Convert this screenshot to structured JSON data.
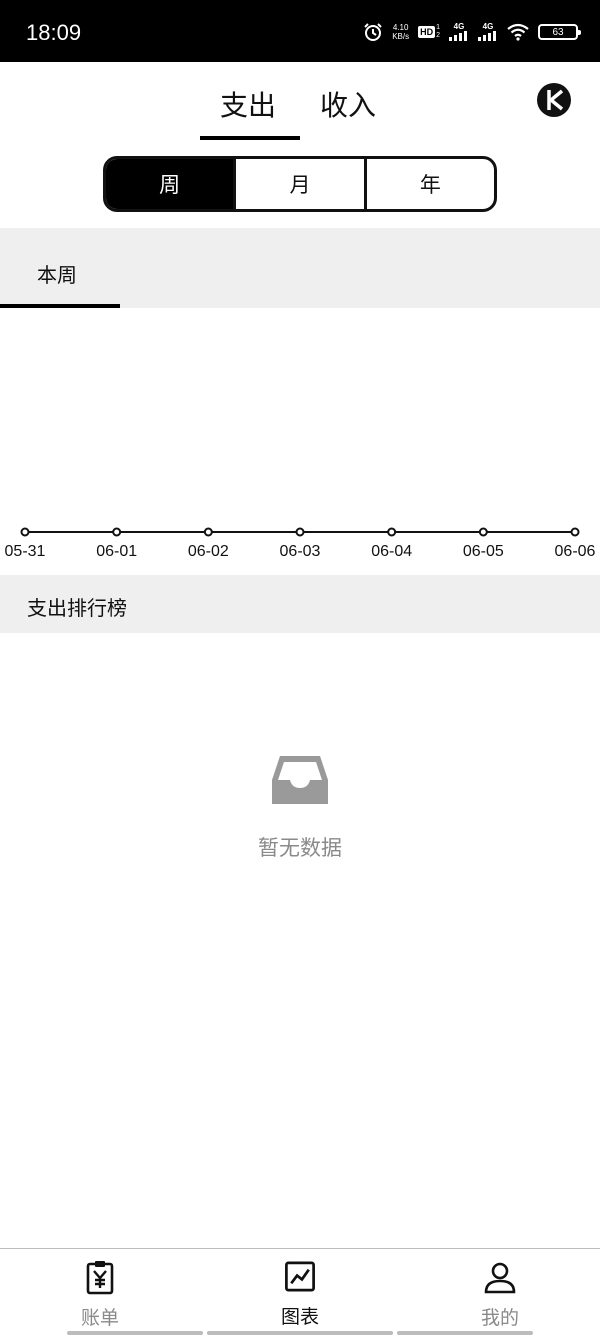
{
  "status_bar": {
    "time": "18:09",
    "net_speed_value": "4.10",
    "net_speed_unit": "KB/s",
    "hd_badge": "HD",
    "hd_sim_top": "1",
    "hd_sim_bottom": "2",
    "signal1_label": "4G",
    "signal2_label": "4G",
    "battery_level": "63",
    "icons": [
      "alarm-icon",
      "hd-icon",
      "signal-icon",
      "signal-icon",
      "wifi-icon",
      "battery-icon"
    ]
  },
  "top_tabs": {
    "expense": "支出",
    "income": "收入",
    "active": "expense",
    "switch_icon": "pie-chart-icon"
  },
  "period": {
    "week": "周",
    "month": "月",
    "year": "年",
    "active": "week"
  },
  "week_tab": {
    "label": "本周"
  },
  "chart_data": {
    "type": "line",
    "categories": [
      "05-31",
      "06-01",
      "06-02",
      "06-03",
      "06-04",
      "06-05",
      "06-06"
    ],
    "values": [
      0,
      0,
      0,
      0,
      0,
      0,
      0
    ]
  },
  "ranking": {
    "title": "支出排行榜",
    "empty_text": "暂无数据",
    "empty_icon": "inbox-icon"
  },
  "bottom_nav": {
    "bill": "账单",
    "chart": "图表",
    "me": "我的",
    "active": "chart",
    "icons": [
      "receipt-icon",
      "chart-icon",
      "user-icon"
    ]
  }
}
